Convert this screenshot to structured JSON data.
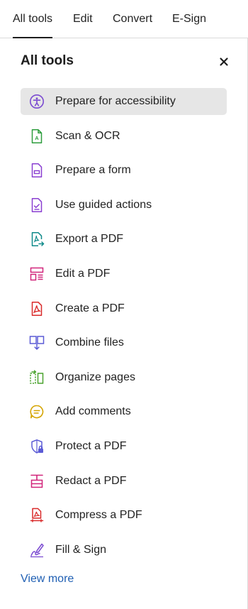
{
  "tabs": [
    {
      "label": "All tools"
    },
    {
      "label": "Edit"
    },
    {
      "label": "Convert"
    },
    {
      "label": "E-Sign"
    }
  ],
  "panel": {
    "title": "All tools",
    "close_icon": "close-icon",
    "view_more": "View more"
  },
  "tools": [
    {
      "label": "Prepare for accessibility",
      "icon": "accessibility-icon",
      "color": "#7b4bd1"
    },
    {
      "label": "Scan & OCR",
      "icon": "scan-ocr-icon",
      "color": "#2e9e3e"
    },
    {
      "label": "Prepare a form",
      "icon": "form-icon",
      "color": "#8a3fd1"
    },
    {
      "label": "Use guided actions",
      "icon": "guided-actions-icon",
      "color": "#8a3fd1"
    },
    {
      "label": "Export a PDF",
      "icon": "export-pdf-icon",
      "color": "#0f8a8a"
    },
    {
      "label": "Edit a PDF",
      "icon": "edit-pdf-icon",
      "color": "#d1247a"
    },
    {
      "label": "Create a PDF",
      "icon": "create-pdf-icon",
      "color": "#d92a2a"
    },
    {
      "label": "Combine files",
      "icon": "combine-files-icon",
      "color": "#5b5bd6"
    },
    {
      "label": "Organize pages",
      "icon": "organize-pages-icon",
      "color": "#4aa32e"
    },
    {
      "label": "Add comments",
      "icon": "comment-icon",
      "color": "#d4a400"
    },
    {
      "label": "Protect a PDF",
      "icon": "protect-icon",
      "color": "#5b5bd6"
    },
    {
      "label": "Redact a PDF",
      "icon": "redact-icon",
      "color": "#d1247a"
    },
    {
      "label": "Compress a PDF",
      "icon": "compress-icon",
      "color": "#d92a2a"
    },
    {
      "label": "Fill & Sign",
      "icon": "fill-sign-icon",
      "color": "#7b4bd1"
    }
  ]
}
